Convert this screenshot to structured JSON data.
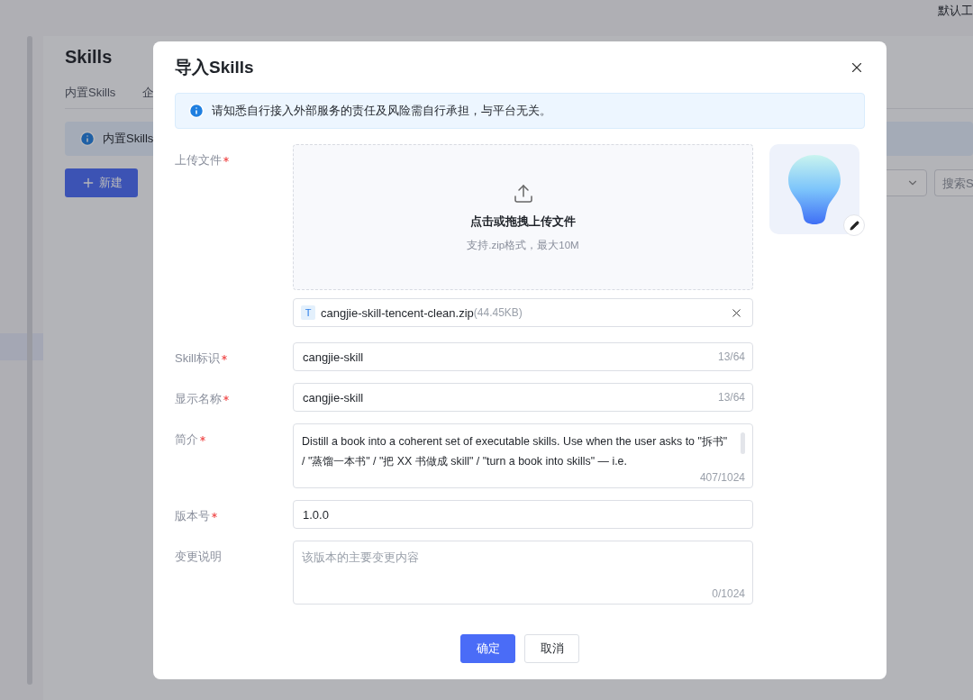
{
  "header": {
    "workspace": "默认工"
  },
  "page": {
    "title": "Skills",
    "tabs": [
      {
        "label": "内置Skills"
      },
      {
        "label": "企"
      }
    ],
    "info": "内置Skills",
    "new_button": {
      "label": "新建"
    },
    "search": {
      "placeholder": "搜索S"
    }
  },
  "modal": {
    "title": "导入Skills",
    "alert": "请知悉自行接入外部服务的责任及风险需自行承担，与平台无关。",
    "upload": {
      "label": "上传文件",
      "required": true,
      "prompt": "点击或拖拽上传文件",
      "hint": "支持.zip格式，最大10M",
      "file": {
        "badge": "T",
        "name": "cangjie-skill-tencent-clean.zip",
        "size": "(44.45KB)"
      }
    },
    "fields": [
      {
        "kind": "input",
        "label": "Skill标识",
        "required": true,
        "value": "cangjie-skill",
        "counter": "13/64"
      },
      {
        "kind": "input",
        "label": "显示名称",
        "required": true,
        "value": "cangjie-skill",
        "counter": "13/64"
      },
      {
        "kind": "textarea",
        "label": "简介",
        "required": true,
        "value": "Distill a book into a coherent set of executable skills. Use when the user asks to \"拆书\" / \"蒸馏一本书\" / \"把 XX 书做成 skill\" / \"turn a book into skills\" — i.e.",
        "counter": "407/1024"
      },
      {
        "kind": "input",
        "label": "版本号",
        "required": true,
        "value": "1.0.0"
      },
      {
        "kind": "textarea",
        "label": "变更说明",
        "required": false,
        "placeholder": "该版本的主要变更内容",
        "counter": "0/1024"
      }
    ],
    "buttons": [
      {
        "label": "确定",
        "kind": "primary"
      },
      {
        "label": "取消",
        "kind": "default"
      }
    ]
  }
}
